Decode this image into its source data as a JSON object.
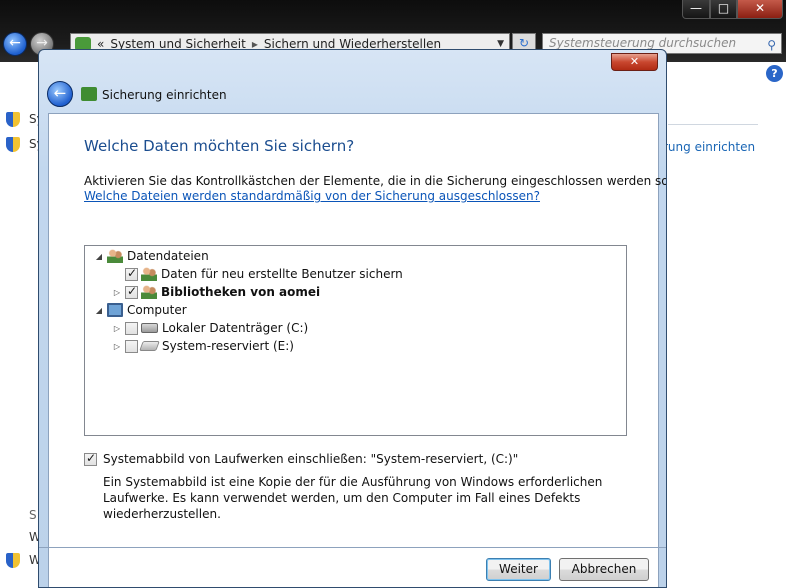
{
  "explorer": {
    "window_controls": {
      "minimize": "—",
      "maximize": "□",
      "close": "✕"
    },
    "back_icon": "back-arrow-icon",
    "forward_icon": "forward-arrow-icon",
    "breadcrumb": {
      "chevron": "«",
      "items": [
        "System und Sicherheit",
        "Sichern und Wiederherstellen"
      ],
      "separator": "▸"
    },
    "refresh_glyph": "↻",
    "search_placeholder": "Systemsteuerung durchsuchen",
    "search_glyph": "⚲",
    "help_glyph": "?",
    "side_link": "rung einrichten",
    "left_fragments": [
      "Sys",
      "Sy",
      "S",
      "W",
      "W"
    ]
  },
  "dialog": {
    "close_glyph": "✕",
    "back_glyph": "←",
    "title": "Sicherung einrichten",
    "heading": "Welche Daten möchten Sie sichern?",
    "instruction": "Aktivieren Sie das Kontrollkästchen der Elemente, die in die Sicherung eingeschlossen werden sollen.",
    "excluded_link": "Welche Dateien werden standardmäßig von der Sicherung ausgeschlossen?",
    "tree": {
      "expand_open": "◢",
      "expand_closed": "▷",
      "items": [
        {
          "label": "Datendateien",
          "level": 0,
          "expander": "open",
          "checkbox": false,
          "checked": false,
          "icon": "users-icon",
          "bold": false
        },
        {
          "label": "Daten für neu erstellte Benutzer sichern",
          "level": 1,
          "expander": "none",
          "checkbox": true,
          "checked": true,
          "icon": "users-icon",
          "bold": false
        },
        {
          "label": "Bibliotheken von aomei",
          "level": 1,
          "expander": "closed",
          "checkbox": true,
          "checked": true,
          "icon": "users-icon",
          "bold": true
        },
        {
          "label": "Computer",
          "level": 0,
          "expander": "open",
          "checkbox": false,
          "checked": false,
          "icon": "computer-icon",
          "bold": false
        },
        {
          "label": "Lokaler Datenträger (C:)",
          "level": 1,
          "expander": "closed",
          "checkbox": true,
          "checked": false,
          "icon": "drive-icon",
          "bold": false
        },
        {
          "label": "System-reserviert (E:)",
          "level": 1,
          "expander": "closed",
          "checkbox": true,
          "checked": false,
          "icon": "drive-icon",
          "bold": false
        }
      ]
    },
    "system_image": {
      "checked": true,
      "label": "Systemabbild von Laufwerken einschließen: \"System-reserviert, (C:)\"",
      "description": "Ein Systemabbild ist eine Kopie der für die Ausführung von Windows erforderlichen Laufwerke. Es kann verwendet werden, um den Computer im Fall eines Defekts wiederherzustellen."
    },
    "buttons": {
      "next": "Weiter",
      "cancel": "Abbrechen"
    }
  }
}
